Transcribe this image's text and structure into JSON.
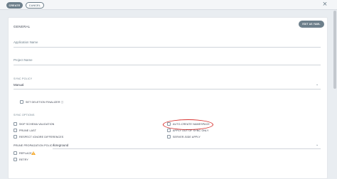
{
  "toolbar": {
    "create_label": "CREATE",
    "cancel_label": "CANCEL"
  },
  "general": {
    "title": "GENERAL",
    "edit_yaml_label": "EDIT AS YAML",
    "application_name_label": "Application Name",
    "project_name_label": "Project Name"
  },
  "sync_policy": {
    "label": "SYNC POLICY",
    "selected": "Manual",
    "set_deletion_finalizer_label": "SET DELETION FINALIZER ⓘ"
  },
  "sync_options": {
    "title": "SYNC OPTIONS",
    "skip_schema_validation": "SKIP SCHEMA VALIDATION",
    "prune_last": "PRUNE LAST",
    "respect_ignore_differences": "RESPECT IGNORE DIFFERENCES",
    "auto_create_namespace": "AUTO-CREATE NAMESPACE",
    "apply_out_of_sync_only": "APPLY OUT OF SYNC ONLY",
    "server_side_apply": "SERVER-SIDE APPLY",
    "prune_propagation_policy_label": "PRUNE PROPAGATION POLICY:",
    "prune_propagation_policy_value": "foreground",
    "replace": "REPLACE",
    "retry": "RETRY"
  },
  "colors": {
    "primary_button": "#6d7f8b",
    "highlight_ring": "#d6302d",
    "warning_icon": "#f5a623"
  }
}
